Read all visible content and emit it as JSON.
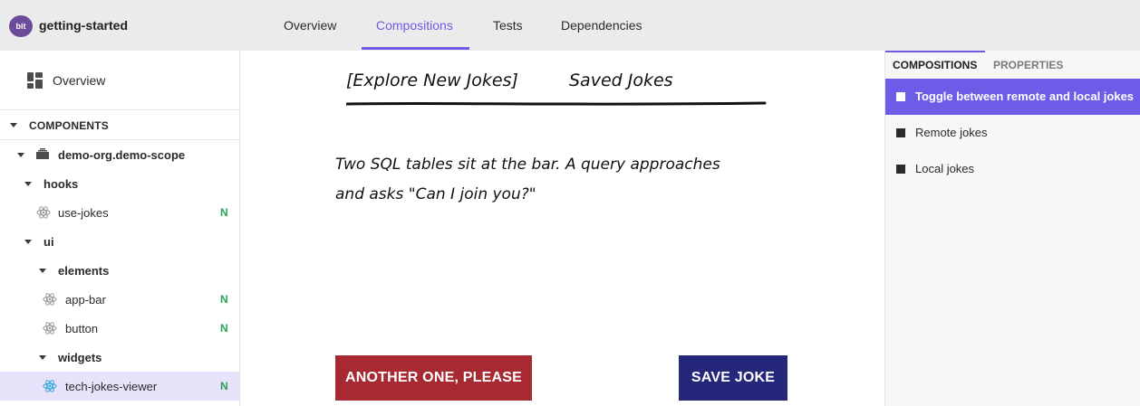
{
  "header": {
    "logo_text": "bit",
    "scope_name": "getting-started",
    "tabs": [
      {
        "label": "Overview",
        "active": false
      },
      {
        "label": "Compositions",
        "active": true
      },
      {
        "label": "Tests",
        "active": false
      },
      {
        "label": "Dependencies",
        "active": false
      }
    ],
    "accent_color": "#6c5ce7"
  },
  "sidebar": {
    "overview_label": "Overview",
    "components_header": "COMPONENTS",
    "tree": [
      {
        "label": "demo-org.demo-scope",
        "kind": "scope",
        "badge": ""
      },
      {
        "label": "hooks",
        "kind": "folder",
        "badge": ""
      },
      {
        "label": "use-jokes",
        "kind": "component",
        "badge": "N"
      },
      {
        "label": "ui",
        "kind": "folder",
        "badge": ""
      },
      {
        "label": "elements",
        "kind": "folder",
        "badge": ""
      },
      {
        "label": "app-bar",
        "kind": "component",
        "badge": "N"
      },
      {
        "label": "button",
        "kind": "component",
        "badge": "N"
      },
      {
        "label": "widgets",
        "kind": "folder",
        "badge": ""
      },
      {
        "label": "tech-jokes-viewer",
        "kind": "component",
        "badge": "N",
        "selected": true
      }
    ]
  },
  "preview": {
    "nav_explore": "[Explore New Jokes]",
    "nav_saved": "Saved Jokes",
    "joke_line1": "Two SQL tables sit at the bar. A query approaches",
    "joke_line2": "and asks \"Can I join you?\"",
    "another_button": "ANOTHER ONE, PLEASE",
    "save_button": "SAVE JOKE",
    "another_color": "#a72a33",
    "save_color": "#25287a"
  },
  "right_panel": {
    "tabs": [
      {
        "label": "COMPOSITIONS",
        "active": true
      },
      {
        "label": "PROPERTIES",
        "active": false
      }
    ],
    "compositions": [
      {
        "label": "Toggle between remote and local jokes",
        "active": true
      },
      {
        "label": "Remote jokes",
        "active": false
      },
      {
        "label": "Local jokes",
        "active": false
      }
    ]
  }
}
